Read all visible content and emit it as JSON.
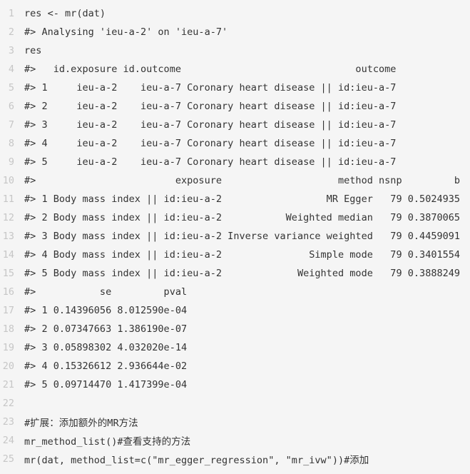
{
  "code": {
    "lines": [
      {
        "number": "1",
        "text": "res <- mr(dat)"
      },
      {
        "number": "2",
        "text": "#> Analysing 'ieu-a-2' on 'ieu-a-7'"
      },
      {
        "number": "3",
        "text": "res"
      },
      {
        "number": "4",
        "text": "#>   id.exposure id.outcome                              outcome"
      },
      {
        "number": "5",
        "text": "#> 1     ieu-a-2    ieu-a-7 Coronary heart disease || id:ieu-a-7"
      },
      {
        "number": "6",
        "text": "#> 2     ieu-a-2    ieu-a-7 Coronary heart disease || id:ieu-a-7"
      },
      {
        "number": "7",
        "text": "#> 3     ieu-a-2    ieu-a-7 Coronary heart disease || id:ieu-a-7"
      },
      {
        "number": "8",
        "text": "#> 4     ieu-a-2    ieu-a-7 Coronary heart disease || id:ieu-a-7"
      },
      {
        "number": "9",
        "text": "#> 5     ieu-a-2    ieu-a-7 Coronary heart disease || id:ieu-a-7"
      },
      {
        "number": "10",
        "text": "#>                        exposure                    method nsnp         b"
      },
      {
        "number": "11",
        "text": "#> 1 Body mass index || id:ieu-a-2                  MR Egger   79 0.5024935"
      },
      {
        "number": "12",
        "text": "#> 2 Body mass index || id:ieu-a-2           Weighted median   79 0.3870065"
      },
      {
        "number": "13",
        "text": "#> 3 Body mass index || id:ieu-a-2 Inverse variance weighted   79 0.4459091"
      },
      {
        "number": "14",
        "text": "#> 4 Body mass index || id:ieu-a-2               Simple mode   79 0.3401554"
      },
      {
        "number": "15",
        "text": "#> 5 Body mass index || id:ieu-a-2             Weighted mode   79 0.3888249"
      },
      {
        "number": "16",
        "text": "#>           se         pval"
      },
      {
        "number": "17",
        "text": "#> 1 0.14396056 8.012590e-04"
      },
      {
        "number": "18",
        "text": "#> 2 0.07347663 1.386190e-07"
      },
      {
        "number": "19",
        "text": "#> 3 0.05898302 4.032020e-14"
      },
      {
        "number": "20",
        "text": "#> 4 0.15326612 2.936644e-02"
      },
      {
        "number": "21",
        "text": "#> 5 0.09714470 1.417399e-04"
      },
      {
        "number": "22",
        "text": ""
      },
      {
        "number": "23",
        "text": "#扩展：添加额外的MR方法"
      },
      {
        "number": "24",
        "text": "mr_method_list()#查看支持的方法"
      },
      {
        "number": "25",
        "text": "mr(dat, method_list=c(\"mr_egger_regression\", \"mr_ivw\"))#添加"
      }
    ]
  }
}
